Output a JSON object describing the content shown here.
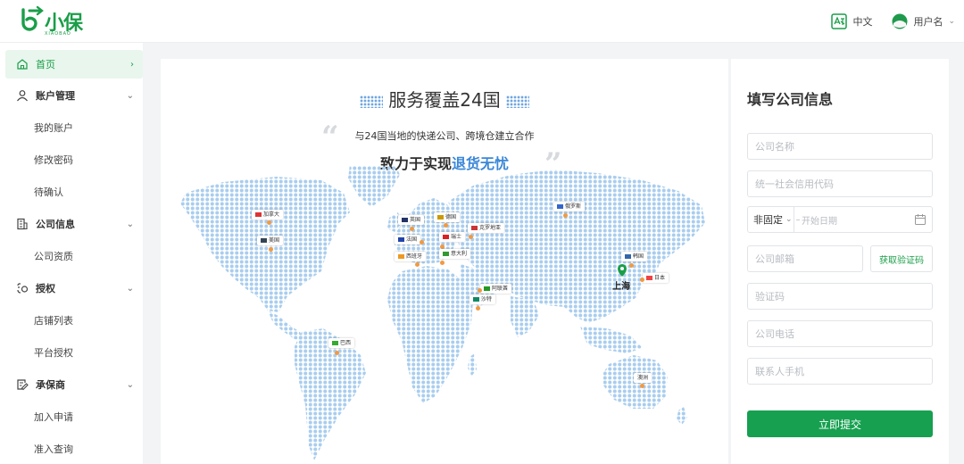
{
  "header": {
    "logo_text": "小保",
    "logo_sub": "XIAOBAO",
    "language": "中文",
    "username": "用户名"
  },
  "sidebar": {
    "home": "首页",
    "account_group": "账户管理",
    "account_items": [
      "我的账户",
      "修改密码",
      "待确认"
    ],
    "company_group": "公司信息",
    "company_items": [
      "公司资质"
    ],
    "auth_group": "授权",
    "auth_items": [
      "店铺列表",
      "平台授权"
    ],
    "insurer_group": "承保商",
    "insurer_items": [
      "加入申请",
      "准入查询"
    ]
  },
  "map": {
    "title": "服务覆盖24国",
    "sub1": "与24国当地的快递公司、跨境仓建立合作",
    "sub2_prefix": "致力于实现",
    "sub2_highlight": "退货无忧",
    "hub_label": "上海",
    "countries": [
      "加拿大",
      "美国",
      "英国",
      "德国",
      "法国",
      "瑞士",
      "意大利",
      "西班牙",
      "克罗地亚",
      "俄罗斯",
      "韩国",
      "日本",
      "阿联酋",
      "沙特",
      "巴西",
      "澳洲"
    ]
  },
  "form": {
    "title": "填写公司信息",
    "company_name_ph": "公司名称",
    "credit_code_ph": "统一社会信用代码",
    "term_type": "非固定",
    "start_date_ph": "开始日期",
    "email_ph": "公司邮箱",
    "get_code": "获取验证码",
    "code_ph": "验证码",
    "phone_ph": "公司电话",
    "mobile_ph": "联系人手机",
    "submit": "立即提交"
  }
}
